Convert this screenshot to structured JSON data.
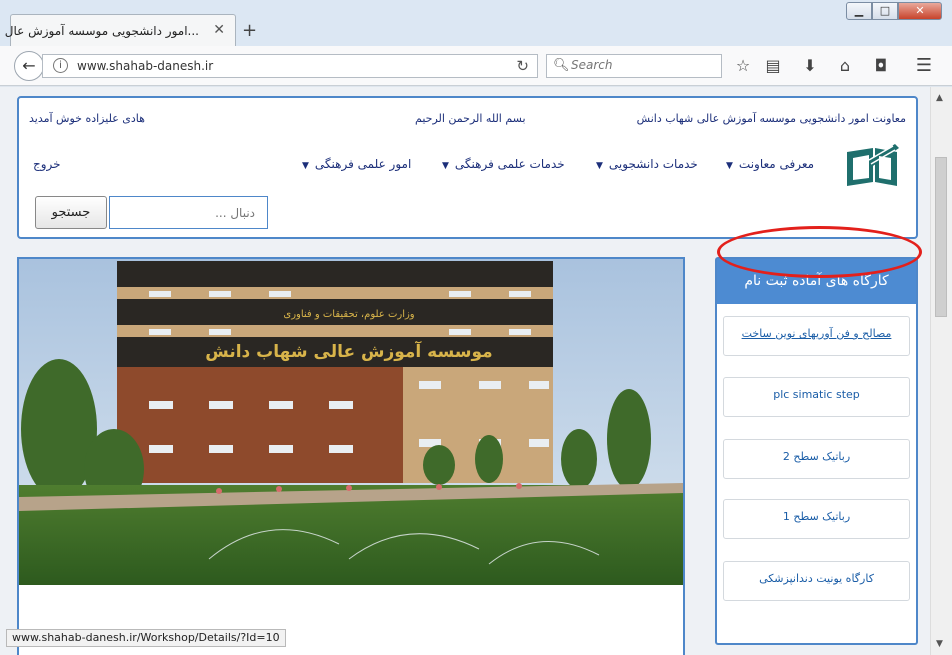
{
  "browser": {
    "tab_title": "...امور دانشجویی موسسه آموزش عال",
    "tab_close": "✕",
    "new_tab": "+",
    "window": {
      "minimize": "▁",
      "maximize": "□",
      "close": "✕"
    },
    "url": "www.shahab-danesh.ir",
    "search_placeholder": "Search",
    "status_url": "www.shahab-danesh.ir/Workshop/Details/?Id=10"
  },
  "header": {
    "org_title": "معاونت امور دانشجویی موسسه آموزش عالی شهاب دانش",
    "bismillah": "بسم الله الرحمن الرحیم",
    "welcome": "هادی علیزاده خوش آمدید",
    "exit": "خروج",
    "menu": [
      {
        "label": "معرفی معاونت"
      },
      {
        "label": "خدمات دانشجویی"
      },
      {
        "label": "خدمات علمی فرهنگی"
      },
      {
        "label": "امور علمی فرهنگی"
      }
    ],
    "search_placeholder": "دنبال ...",
    "search_button": "جستجو"
  },
  "photo": {
    "building_sign": "موسسه آموزش عالی شهاب دانش",
    "ministry_sign": "وزارت علوم، تحقیقات و فناوری"
  },
  "sidebar": {
    "title": "کارگاه های آماده ثبت نام",
    "workshops": [
      {
        "label": "مصالح و فن آوریهای نوین ساخت"
      },
      {
        "label": "plc simatic step"
      },
      {
        "label": "رباتیک سطح 2"
      },
      {
        "label": "رباتیک سطح 1"
      },
      {
        "label": "کارگاه یونیت دندانپزشکی"
      }
    ]
  },
  "colors": {
    "accent_blue": "#4e87c9",
    "sidebar_header": "#4d8bd2",
    "link_navy": "#1c2f7a",
    "highlight_red": "#e3201b"
  }
}
